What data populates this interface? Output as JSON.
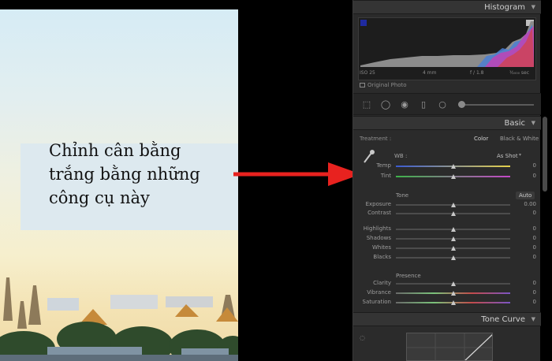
{
  "callout": {
    "line1": "Chỉnh cân bằng",
    "line2": "trắng bằng những",
    "line3": "công cụ này"
  },
  "histogram": {
    "title": "Histogram",
    "iso": "ISO 25",
    "focal": "4 mm",
    "aperture": "f / 1.8",
    "shutter": "¹⁄₂₀₀₀ sec",
    "original_photo": "Original Photo"
  },
  "basic": {
    "title": "Basic",
    "treatment_label": "Treatment :",
    "color": "Color",
    "bw": "Black & White",
    "wb_label": "WB :",
    "wb_value": "As Shot",
    "tone_label": "Tone",
    "auto": "Auto",
    "presence_label": "Presence",
    "sliders": {
      "temp": {
        "label": "Temp",
        "value": "0",
        "level": 0.5
      },
      "tint": {
        "label": "Tint",
        "value": "0",
        "level": 0.5
      },
      "exposure": {
        "label": "Exposure",
        "value": "0.00",
        "level": 0.5
      },
      "contrast": {
        "label": "Contrast",
        "value": "0",
        "level": 0.5
      },
      "highlights": {
        "label": "Highlights",
        "value": "0",
        "level": 0.5
      },
      "shadows": {
        "label": "Shadows",
        "value": "0",
        "level": 0.5
      },
      "whites": {
        "label": "Whites",
        "value": "0",
        "level": 0.5
      },
      "blacks": {
        "label": "Blacks",
        "value": "0",
        "level": 0.5
      },
      "clarity": {
        "label": "Clarity",
        "value": "0",
        "level": 0.5
      },
      "vibrance": {
        "label": "Vibrance",
        "value": "0",
        "level": 0.5
      },
      "saturation": {
        "label": "Saturation",
        "value": "0",
        "level": 0.5
      }
    }
  },
  "tone_curve": {
    "title": "Tone Curve"
  },
  "colors": {
    "arrow": "#e8221f",
    "panel": "#2b2b2b",
    "header": "#343434"
  }
}
